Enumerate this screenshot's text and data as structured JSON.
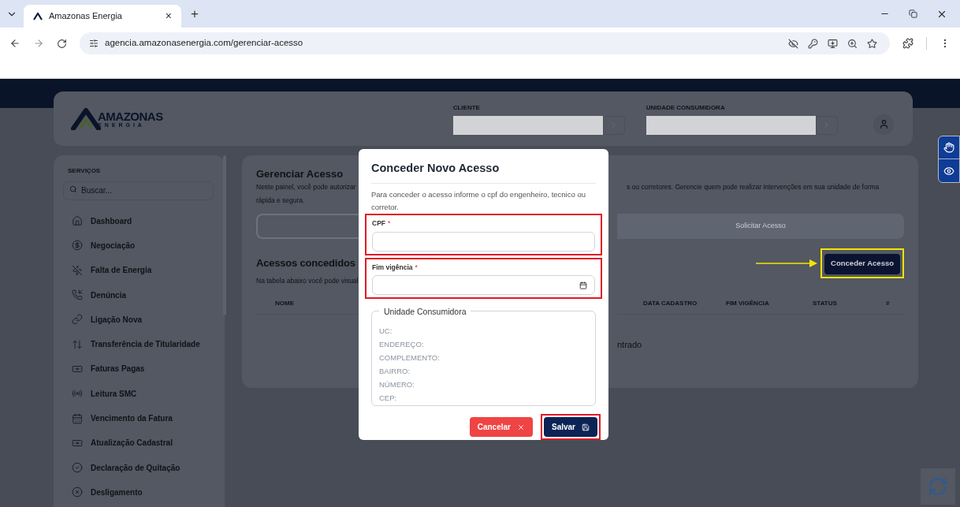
{
  "browser": {
    "tab_title": "Amazonas Energia",
    "tab_close": "×",
    "new_tab": "+",
    "url": "agencia.amazonasenergia.com/gerenciar-acesso"
  },
  "header": {
    "logo_top": "AMAZONAS",
    "logo_bottom": "ENERGIA",
    "fields": [
      {
        "label": "CLIENTE"
      },
      {
        "label": "UNIDADE CONSUMIDORA"
      }
    ]
  },
  "sidebar": {
    "heading": "SERVIÇOS",
    "search_placeholder": "Buscar...",
    "items": [
      {
        "label": "Dashboard"
      },
      {
        "label": "Negociação"
      },
      {
        "label": "Falta de Energia"
      },
      {
        "label": "Denúncia"
      },
      {
        "label": "Ligação Nova"
      },
      {
        "label": "Transferência de Titularidade"
      },
      {
        "label": "Faturas Pagas"
      },
      {
        "label": "Leitura SMC"
      },
      {
        "label": "Vencimento da Fatura"
      },
      {
        "label": "Atualização Cadastral"
      },
      {
        "label": "Declaração de Quitação"
      },
      {
        "label": "Desligamento"
      }
    ]
  },
  "main": {
    "title": "Gerenciar Acesso",
    "description_left": "Neste painel, você pode autorizar",
    "description_right": "s ou corretores. Gerencie quem pode realizar intervenções em sua unidade de forma",
    "description_line2": "rápida e segura.",
    "request_button": "Solicitar Acesso",
    "section_title": "Acessos concedidos",
    "section_text": "Na tabela abaixo você pode visual",
    "grant_button": {
      "label": "Conceder Acesso",
      "highlighted": true,
      "arrow": true
    },
    "table": {
      "columns": [
        {
          "label": "NOME"
        },
        {
          "label": "DATA CADASTRO"
        },
        {
          "label": "FIM VIGÊNCIA"
        },
        {
          "label": "STATUS"
        },
        {
          "label": "#"
        }
      ],
      "empty_message": "ntrado"
    }
  },
  "modal": {
    "title": "Conceder Novo Acesso",
    "description": "Para conceder o acesso informe o cpf do engenheiro, tecnico ou corretor.",
    "fields": [
      {
        "label": "CPF",
        "required_mark": "*",
        "kind": "text",
        "highlighted": true
      },
      {
        "label": "Fim vigência",
        "required_mark": "*",
        "kind": "date",
        "highlighted": true
      }
    ],
    "fieldset": {
      "legend": "Unidade Consumidora",
      "lines": [
        "UC:",
        "ENDEREÇO:",
        "COMPLEMENTO:",
        "BAIRRO:",
        "NÚMERO:",
        "CEP:"
      ]
    },
    "buttons": [
      {
        "label": "Cancelar",
        "kind": "cancel",
        "highlighted": false
      },
      {
        "label": "Salvar",
        "kind": "save",
        "highlighted": true
      }
    ]
  }
}
